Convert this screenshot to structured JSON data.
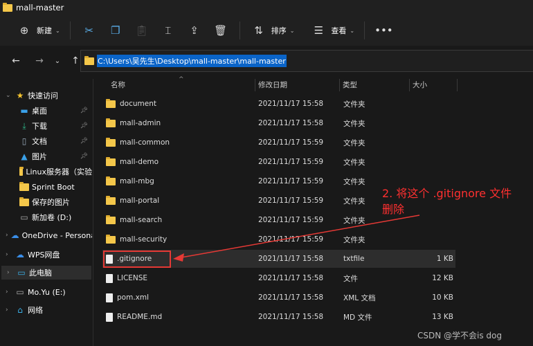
{
  "window": {
    "title": "mall-master"
  },
  "toolbar": {
    "new_label": "新建",
    "sort_label": "排序",
    "view_label": "查看",
    "icons": [
      "plus-circle-icon",
      "cut-icon",
      "copy-icon",
      "paste-icon",
      "rename-icon",
      "share-icon",
      "delete-icon",
      "sort-icon",
      "view-icon",
      "more-icon"
    ]
  },
  "address": {
    "path": "C:\\Users\\吴先生\\Desktop\\mall-master\\mall-master"
  },
  "sidebar": {
    "items": [
      {
        "label": "快速访问",
        "icon": "star-icon"
      },
      {
        "label": "桌面",
        "icon": "desktop-icon",
        "pinned": true
      },
      {
        "label": "下载",
        "icon": "download-icon",
        "pinned": true
      },
      {
        "label": "文档",
        "icon": "document-icon",
        "pinned": true
      },
      {
        "label": "图片",
        "icon": "pictures-icon",
        "pinned": true
      },
      {
        "label": "Linux服务器（实验",
        "icon": "folder-icon"
      },
      {
        "label": "Sprint Boot",
        "icon": "folder-icon"
      },
      {
        "label": "保存的图片",
        "icon": "folder-icon"
      },
      {
        "label": "新加卷 (D:)",
        "icon": "drive-icon"
      },
      {
        "label": "OneDrive - Persona",
        "icon": "cloud-icon"
      },
      {
        "label": "WPS网盘",
        "icon": "cloud-icon"
      },
      {
        "label": "此电脑",
        "icon": "computer-icon"
      },
      {
        "label": "Mo.Yu (E:)",
        "icon": "drive-icon"
      },
      {
        "label": "网络",
        "icon": "network-icon"
      }
    ]
  },
  "columns": {
    "name": "名称",
    "date": "修改日期",
    "type": "类型",
    "size": "大小"
  },
  "files": [
    {
      "name": "document",
      "date": "2021/11/17 15:58",
      "type": "文件夹",
      "size": "",
      "kind": "folder"
    },
    {
      "name": "mall-admin",
      "date": "2021/11/17 15:58",
      "type": "文件夹",
      "size": "",
      "kind": "folder"
    },
    {
      "name": "mall-common",
      "date": "2021/11/17 15:59",
      "type": "文件夹",
      "size": "",
      "kind": "folder"
    },
    {
      "name": "mall-demo",
      "date": "2021/11/17 15:59",
      "type": "文件夹",
      "size": "",
      "kind": "folder"
    },
    {
      "name": "mall-mbg",
      "date": "2021/11/17 15:59",
      "type": "文件夹",
      "size": "",
      "kind": "folder"
    },
    {
      "name": "mall-portal",
      "date": "2021/11/17 15:59",
      "type": "文件夹",
      "size": "",
      "kind": "folder"
    },
    {
      "name": "mall-search",
      "date": "2021/11/17 15:59",
      "type": "文件夹",
      "size": "",
      "kind": "folder"
    },
    {
      "name": "mall-security",
      "date": "2021/11/17 15:59",
      "type": "文件夹",
      "size": "",
      "kind": "folder"
    },
    {
      "name": ".gitignore",
      "date": "2021/11/17 15:58",
      "type": "txtfile",
      "size": "1 KB",
      "kind": "file"
    },
    {
      "name": "LICENSE",
      "date": "2021/11/17 15:58",
      "type": "文件",
      "size": "12 KB",
      "kind": "file"
    },
    {
      "name": "pom.xml",
      "date": "2021/11/17 15:58",
      "type": "XML 文档",
      "size": "10 KB",
      "kind": "file"
    },
    {
      "name": "README.md",
      "date": "2021/11/17 15:58",
      "type": "MD 文件",
      "size": "13 KB",
      "kind": "file"
    }
  ],
  "annotation": {
    "line1": "2. 将这个 .gitignore 文件",
    "line2": "删除",
    "color": "#ff3030"
  },
  "watermark": "CSDN @学不会is dog"
}
